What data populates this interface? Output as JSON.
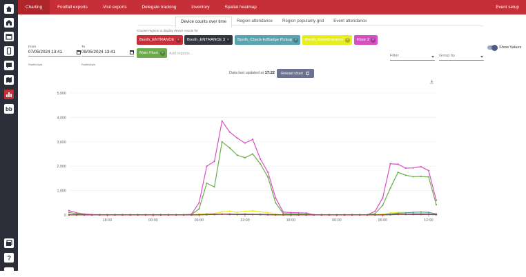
{
  "nav": {
    "items": [
      "Charting",
      "Footfall exports",
      "Visit exports",
      "Delegate tracking",
      "Inventory",
      "Spatial heatmap"
    ],
    "right": "Event setup"
  },
  "sidebar": {
    "top_icons": [
      "home-icon",
      "building-icon",
      "calendar-icon",
      "mobile-icon",
      "message-icon",
      "map-icon",
      "chart-icon",
      "badge-icon"
    ],
    "bottom_icons": [
      "docs-icon",
      "help-icon"
    ]
  },
  "tabs": [
    "Device counts over time",
    "Region attendance",
    "Region popularity grid",
    "Event attendance"
  ],
  "filters": {
    "from_label": "From",
    "from_value": "07/05/2024 13:41",
    "to_label": "To",
    "to_value": "09/05/2024 13:41",
    "timezone": "Pacific/Apia",
    "regions_hint": "Choose regions to display device counts for",
    "add_regions_placeholder": "Add regions...",
    "filter_placeholder": "Filter",
    "groupby_placeholder": "Group by",
    "show_values_label": "Show Values",
    "show_values_on": true
  },
  "regions": [
    {
      "label": "Booth_ENTRANCE",
      "color": "#c7303a"
    },
    {
      "label": "Booth_ENTRANCE 3",
      "color": "#34373f"
    },
    {
      "label": "Booth_Check-In/Badge Pickup",
      "color": "#5aa3b0"
    },
    {
      "label": "Booth_EntreEntrance",
      "color": "#e8ee1c"
    },
    {
      "label": "Floor 2",
      "color": "#d64fc3"
    },
    {
      "label": "Main Floor",
      "color": "#6bab4c"
    }
  ],
  "status": {
    "updated_prefix": "Data last updated at",
    "updated_time": "17:22",
    "reload_label": "Reload chart"
  },
  "chart_data": {
    "type": "line",
    "x_ticks": [
      "18:00",
      "00:00",
      "06:00",
      "12:00",
      "18:00",
      "00:00",
      "06:00",
      "12:00"
    ],
    "y_ticks": [
      "0",
      "1,000",
      "2,000",
      "3,000",
      "4,000",
      "5,000"
    ],
    "ylim": [
      0,
      5000
    ],
    "grid": true,
    "x_hours": [
      13,
      14,
      15,
      16,
      17,
      18,
      19,
      20,
      21,
      22,
      23,
      24,
      25,
      26,
      27,
      28,
      29,
      30,
      31,
      32,
      33,
      34,
      35,
      36,
      37,
      38,
      39,
      40,
      41,
      42,
      43,
      44,
      45,
      46,
      47,
      48,
      49,
      50,
      51,
      52,
      53,
      54,
      55,
      56,
      57,
      58,
      59,
      60,
      61
    ],
    "series": [
      {
        "color": "#d64fc3",
        "values": [
          180,
          90,
          40,
          20,
          10,
          10,
          10,
          10,
          10,
          10,
          10,
          10,
          10,
          10,
          10,
          10,
          30,
          500,
          2000,
          2200,
          3850,
          3400,
          3150,
          2950,
          3100,
          2300,
          1750,
          700,
          120,
          100,
          90,
          80,
          10,
          10,
          10,
          10,
          10,
          10,
          10,
          10,
          150,
          700,
          2100,
          2080,
          1920,
          1930,
          1980,
          1820,
          600
        ]
      },
      {
        "color": "#6bab4c",
        "values": [
          100,
          50,
          20,
          10,
          10,
          10,
          10,
          10,
          10,
          10,
          10,
          10,
          10,
          10,
          10,
          10,
          20,
          250,
          1300,
          1150,
          3000,
          2750,
          2450,
          2350,
          2500,
          2100,
          1550,
          500,
          60,
          50,
          40,
          30,
          10,
          10,
          10,
          10,
          10,
          10,
          10,
          10,
          50,
          400,
          1100,
          1750,
          1630,
          1570,
          1580,
          1560,
          420
        ]
      },
      {
        "color": "#e8ee1c",
        "values": [
          10,
          10,
          10,
          10,
          10,
          10,
          10,
          10,
          10,
          10,
          10,
          10,
          10,
          10,
          10,
          10,
          10,
          30,
          60,
          60,
          130,
          160,
          110,
          150,
          170,
          130,
          100,
          30,
          10,
          10,
          10,
          10,
          10,
          10,
          10,
          10,
          10,
          10,
          10,
          10,
          10,
          30,
          90,
          110,
          100,
          110,
          130,
          100,
          50
        ]
      },
      {
        "color": "#5aa3b0",
        "values": [
          5,
          5,
          5,
          5,
          5,
          5,
          5,
          5,
          5,
          5,
          5,
          5,
          5,
          5,
          5,
          5,
          5,
          10,
          20,
          30,
          40,
          40,
          30,
          40,
          30,
          30,
          20,
          10,
          5,
          5,
          5,
          5,
          5,
          5,
          5,
          5,
          5,
          5,
          5,
          5,
          5,
          10,
          40,
          70,
          90,
          110,
          120,
          110,
          40
        ]
      },
      {
        "color": "#34373f",
        "values": [
          5,
          5,
          5,
          5,
          5,
          5,
          5,
          5,
          5,
          5,
          5,
          5,
          5,
          5,
          5,
          5,
          5,
          10,
          15,
          20,
          30,
          30,
          20,
          25,
          20,
          20,
          15,
          10,
          5,
          5,
          5,
          5,
          5,
          5,
          5,
          5,
          5,
          5,
          5,
          5,
          5,
          5,
          20,
          30,
          30,
          40,
          40,
          35,
          20
        ]
      },
      {
        "color": "#c7303a",
        "values": [
          5,
          5,
          5,
          5,
          5,
          5,
          5,
          5,
          5,
          5,
          5,
          5,
          5,
          5,
          5,
          5,
          5,
          10,
          20,
          20,
          30,
          20,
          20,
          20,
          20,
          15,
          10,
          5,
          5,
          5,
          5,
          5,
          5,
          5,
          5,
          5,
          5,
          5,
          5,
          5,
          5,
          5,
          10,
          20,
          20,
          20,
          20,
          20,
          10
        ]
      }
    ]
  }
}
